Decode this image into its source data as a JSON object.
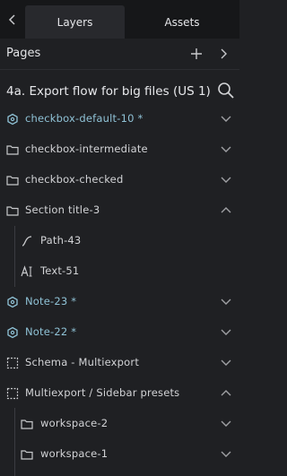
{
  "tabs": [
    {
      "label": "Layers",
      "active": true
    },
    {
      "label": "Assets",
      "active": false
    }
  ],
  "pages_section": {
    "title": "Pages"
  },
  "current_page": {
    "name": "4a. Export flow for big files (US 1)"
  },
  "layers": [
    {
      "label": "checkbox-default-10 *",
      "icon": "component-icon",
      "type": "component",
      "chevron": "down"
    },
    {
      "label": "checkbox-intermediate",
      "icon": "folder-icon",
      "type": "board",
      "chevron": "down"
    },
    {
      "label": "checkbox-checked",
      "icon": "folder-icon",
      "type": "board",
      "chevron": "down"
    },
    {
      "label": "Section title-3",
      "icon": "folder-icon",
      "type": "board",
      "chevron": "up"
    },
    {
      "label": "Path-43",
      "icon": "path-icon",
      "type": "path",
      "chevron": null
    },
    {
      "label": "Text-51",
      "icon": "text-icon",
      "type": "text",
      "chevron": null
    },
    {
      "label": "Note-23 *",
      "icon": "component-icon",
      "type": "component",
      "chevron": "down"
    },
    {
      "label": "Note-22 *",
      "icon": "component-icon",
      "type": "component",
      "chevron": "down"
    },
    {
      "label": "Schema - Multiexport",
      "icon": "frame-icon",
      "type": "frame",
      "chevron": "down"
    },
    {
      "label": "Multiexport / Sidebar presets",
      "icon": "frame-icon",
      "type": "frame",
      "chevron": "up"
    },
    {
      "label": "workspace-2",
      "icon": "folder-icon",
      "type": "board",
      "chevron": "down"
    },
    {
      "label": "workspace-1",
      "icon": "folder-icon",
      "type": "board",
      "chevron": "down"
    }
  ],
  "colors": {
    "component": "#8fc2d6",
    "text": "#d2d3d6",
    "background": "#1f2023"
  }
}
